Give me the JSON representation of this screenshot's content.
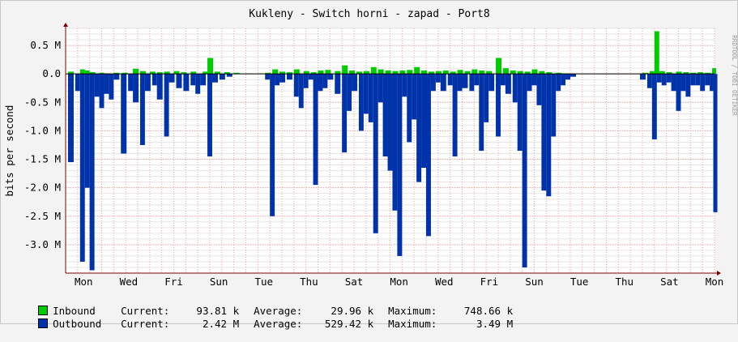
{
  "watermark": "RRDTOOL / TOBI OETIKER",
  "colors": {
    "inbound": "#00CC00",
    "outbound": "#0033AA",
    "grid": "#ff9d9d",
    "axis": "#7f0000"
  },
  "chart_data": {
    "type": "area",
    "title": "Kukleny - Switch horni - zapad - Port8",
    "ylabel": "bits per second",
    "xlabel": "",
    "ylim": [
      -3.5,
      0.8
    ],
    "yticks": [
      0.5,
      0.0,
      -0.5,
      -1.0,
      -1.5,
      -2.0,
      -2.5,
      -3.0
    ],
    "ytick_labels": [
      "0.5 M",
      "0.0",
      "-0.5 M",
      "-1.0 M",
      "-1.5 M",
      "-2.0 M",
      "-2.5 M",
      "-3.0 M"
    ],
    "x_day_labels": [
      "Mon",
      "Wed",
      "Fri",
      "Sun",
      "Tue",
      "Thu",
      "Sat",
      "Mon",
      "Wed",
      "Fri",
      "Sun",
      "Tue",
      "Thu",
      "Sat",
      "Mon"
    ],
    "grid": true,
    "series": [
      {
        "name": "Inbound",
        "unit": "M",
        "note": "values in millions of bits per second, positive (plotted above zero)",
        "points": [
          [
            0.2,
            0.04
          ],
          [
            1.2,
            0.08
          ],
          [
            1.6,
            0.06
          ],
          [
            2.0,
            0.03
          ],
          [
            2.8,
            0.02
          ],
          [
            3.2,
            0.01
          ],
          [
            4.0,
            0.02
          ],
          [
            4.7,
            0.02
          ],
          [
            5.6,
            0.09
          ],
          [
            6.2,
            0.05
          ],
          [
            7.0,
            0.04
          ],
          [
            7.6,
            0.03
          ],
          [
            8.2,
            0.04
          ],
          [
            9.0,
            0.05
          ],
          [
            9.6,
            0.03
          ],
          [
            10.4,
            0.04
          ],
          [
            11.4,
            0.04
          ],
          [
            11.8,
            0.28
          ],
          [
            12.4,
            0.04
          ],
          [
            13.2,
            0.03
          ],
          [
            14.0,
            0.02
          ],
          [
            15.0,
            0.01
          ],
          [
            16.0,
            0.01
          ],
          [
            16.6,
            0.02
          ],
          [
            17.2,
            0.08
          ],
          [
            17.8,
            0.04
          ],
          [
            18.4,
            0.03
          ],
          [
            19.0,
            0.08
          ],
          [
            19.8,
            0.05
          ],
          [
            20.4,
            0.03
          ],
          [
            21.0,
            0.06
          ],
          [
            21.6,
            0.07
          ],
          [
            22.4,
            0.05
          ],
          [
            23.0,
            0.15
          ],
          [
            23.6,
            0.06
          ],
          [
            24.2,
            0.04
          ],
          [
            24.8,
            0.05
          ],
          [
            25.4,
            0.12
          ],
          [
            26.0,
            0.08
          ],
          [
            26.6,
            0.06
          ],
          [
            27.2,
            0.05
          ],
          [
            27.8,
            0.06
          ],
          [
            28.4,
            0.07
          ],
          [
            29.0,
            0.12
          ],
          [
            29.6,
            0.06
          ],
          [
            30.2,
            0.04
          ],
          [
            30.8,
            0.05
          ],
          [
            31.4,
            0.06
          ],
          [
            32.0,
            0.04
          ],
          [
            32.6,
            0.07
          ],
          [
            33.2,
            0.05
          ],
          [
            33.8,
            0.08
          ],
          [
            34.4,
            0.06
          ],
          [
            35.0,
            0.05
          ],
          [
            35.8,
            0.28
          ],
          [
            36.4,
            0.1
          ],
          [
            37.0,
            0.06
          ],
          [
            37.6,
            0.05
          ],
          [
            38.2,
            0.04
          ],
          [
            38.8,
            0.08
          ],
          [
            39.4,
            0.05
          ],
          [
            40.0,
            0.03
          ],
          [
            40.8,
            0.02
          ],
          [
            41.4,
            0.01
          ],
          [
            48.0,
            0.02
          ],
          [
            48.6,
            0.05
          ],
          [
            49.0,
            0.75
          ],
          [
            49.4,
            0.05
          ],
          [
            50.0,
            0.03
          ],
          [
            50.8,
            0.04
          ],
          [
            51.4,
            0.03
          ],
          [
            52.0,
            0.02
          ],
          [
            52.6,
            0.03
          ],
          [
            53.2,
            0.02
          ],
          [
            53.8,
            0.1
          ]
        ]
      },
      {
        "name": "Outbound",
        "unit": "M",
        "note": "values in millions of bits per second, plotted as negative",
        "points": [
          [
            0.2,
            -1.55
          ],
          [
            0.8,
            -0.3
          ],
          [
            1.2,
            -3.3
          ],
          [
            1.6,
            -2.0
          ],
          [
            2.0,
            -3.45
          ],
          [
            2.4,
            -0.4
          ],
          [
            2.8,
            -0.6
          ],
          [
            3.2,
            -0.35
          ],
          [
            3.6,
            -0.45
          ],
          [
            4.0,
            -0.1
          ],
          [
            4.6,
            -1.4
          ],
          [
            5.2,
            -0.3
          ],
          [
            5.6,
            -0.5
          ],
          [
            6.2,
            -1.25
          ],
          [
            6.6,
            -0.3
          ],
          [
            7.2,
            -0.2
          ],
          [
            7.6,
            -0.45
          ],
          [
            8.2,
            -1.1
          ],
          [
            8.6,
            -0.15
          ],
          [
            9.2,
            -0.25
          ],
          [
            9.8,
            -0.3
          ],
          [
            10.4,
            -0.2
          ],
          [
            10.8,
            -0.35
          ],
          [
            11.2,
            -0.2
          ],
          [
            11.8,
            -1.45
          ],
          [
            12.2,
            -0.15
          ],
          [
            12.8,
            -0.1
          ],
          [
            13.4,
            -0.05
          ],
          [
            16.6,
            -0.1
          ],
          [
            17.0,
            -2.5
          ],
          [
            17.4,
            -0.2
          ],
          [
            17.8,
            -0.15
          ],
          [
            18.4,
            -0.1
          ],
          [
            19.0,
            -0.4
          ],
          [
            19.4,
            -0.6
          ],
          [
            19.8,
            -0.25
          ],
          [
            20.2,
            -0.1
          ],
          [
            20.6,
            -1.95
          ],
          [
            21.0,
            -0.3
          ],
          [
            21.4,
            -0.25
          ],
          [
            21.8,
            -0.1
          ],
          [
            22.4,
            -0.35
          ],
          [
            23.0,
            -1.38
          ],
          [
            23.4,
            -0.65
          ],
          [
            23.8,
            -0.3
          ],
          [
            24.4,
            -1.0
          ],
          [
            24.8,
            -0.7
          ],
          [
            25.2,
            -0.85
          ],
          [
            25.6,
            -2.8
          ],
          [
            26.0,
            -0.5
          ],
          [
            26.4,
            -1.45
          ],
          [
            26.8,
            -1.7
          ],
          [
            27.2,
            -2.4
          ],
          [
            27.6,
            -3.2
          ],
          [
            28.0,
            -0.4
          ],
          [
            28.4,
            -1.2
          ],
          [
            28.8,
            -0.8
          ],
          [
            29.2,
            -1.9
          ],
          [
            29.6,
            -1.65
          ],
          [
            30.0,
            -2.85
          ],
          [
            30.4,
            -0.3
          ],
          [
            30.8,
            -0.15
          ],
          [
            31.2,
            -0.3
          ],
          [
            31.8,
            -0.2
          ],
          [
            32.2,
            -1.45
          ],
          [
            32.6,
            -0.3
          ],
          [
            33.0,
            -0.25
          ],
          [
            33.6,
            -0.3
          ],
          [
            34.0,
            -0.2
          ],
          [
            34.4,
            -1.35
          ],
          [
            34.8,
            -0.85
          ],
          [
            35.2,
            -0.3
          ],
          [
            35.8,
            -1.1
          ],
          [
            36.2,
            -0.2
          ],
          [
            36.6,
            -0.35
          ],
          [
            37.2,
            -0.5
          ],
          [
            37.6,
            -1.35
          ],
          [
            38.0,
            -3.4
          ],
          [
            38.4,
            -0.3
          ],
          [
            38.8,
            -0.2
          ],
          [
            39.2,
            -0.55
          ],
          [
            39.6,
            -2.05
          ],
          [
            40.0,
            -2.15
          ],
          [
            40.4,
            -1.1
          ],
          [
            40.8,
            -0.3
          ],
          [
            41.2,
            -0.2
          ],
          [
            41.6,
            -0.1
          ],
          [
            42.0,
            -0.05
          ],
          [
            47.8,
            -0.1
          ],
          [
            48.4,
            -0.25
          ],
          [
            48.8,
            -1.15
          ],
          [
            49.2,
            -0.15
          ],
          [
            49.6,
            -0.2
          ],
          [
            50.0,
            -0.15
          ],
          [
            50.4,
            -0.3
          ],
          [
            50.8,
            -0.65
          ],
          [
            51.2,
            -0.3
          ],
          [
            51.6,
            -0.4
          ],
          [
            52.0,
            -0.2
          ],
          [
            52.4,
            -0.2
          ],
          [
            52.8,
            -0.3
          ],
          [
            53.2,
            -0.2
          ],
          [
            53.6,
            -0.3
          ],
          [
            53.9,
            -2.43
          ]
        ]
      }
    ]
  },
  "legend": [
    {
      "name": "Inbound",
      "current_label": "Current:",
      "current": "93.81 k",
      "average_label": "Average:",
      "average": "29.96 k",
      "maximum_label": "Maximum:",
      "maximum": "748.66 k"
    },
    {
      "name": "Outbound",
      "current_label": "Current:",
      "current": "2.42 M",
      "average_label": "Average:",
      "average": "529.42 k",
      "maximum_label": "Maximum:",
      "maximum": "3.49 M"
    }
  ]
}
